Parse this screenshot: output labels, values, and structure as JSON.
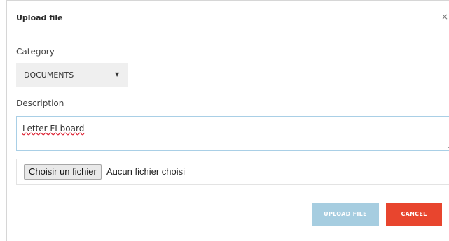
{
  "modal": {
    "title": "Upload file",
    "close_glyph": "×"
  },
  "form": {
    "category_label": "Category",
    "category_value": "DOCUMENTS",
    "category_arrow": "▼",
    "description_label": "Description",
    "description_value": "Letter FI board",
    "file_button_label": "Choisir un fichier",
    "file_status": "Aucun fichier choisi"
  },
  "actions": {
    "upload_label": "UPLOAD FILE",
    "cancel_label": "CANCEL"
  },
  "colors": {
    "upload_button": "#a6cde0",
    "cancel_button": "#e8452e",
    "textarea_border": "#a9cfe6"
  }
}
